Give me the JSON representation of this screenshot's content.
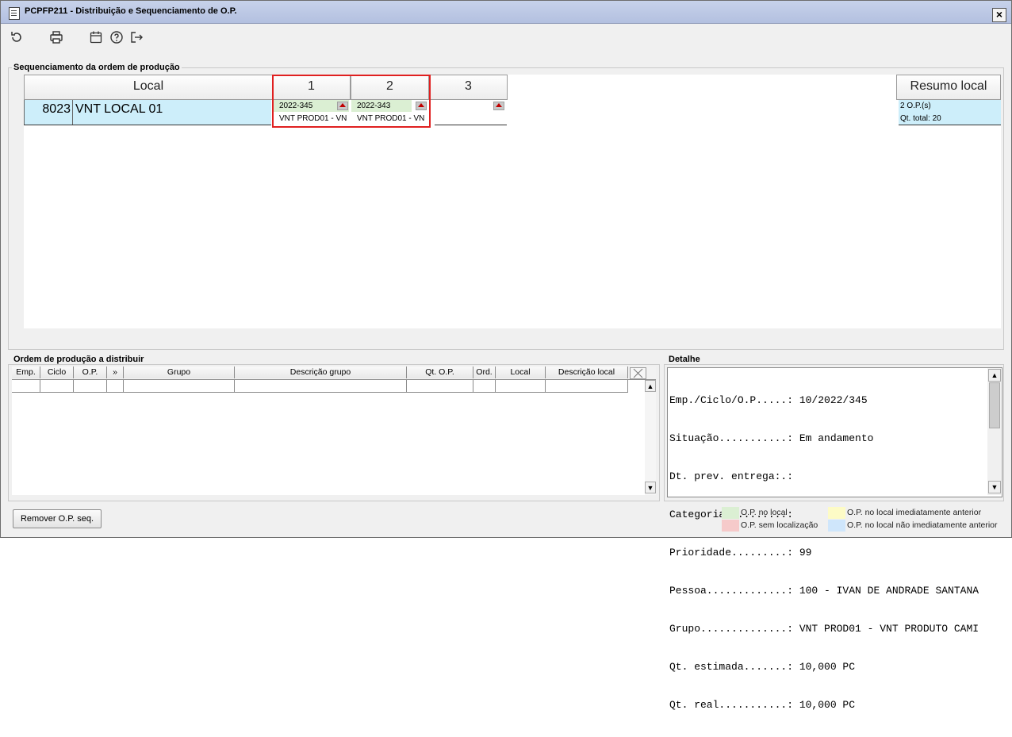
{
  "window": {
    "title": "PCPFP211 - Distribuição e Sequenciamento de O.P.",
    "close_label": "✕"
  },
  "toolbar": {
    "refresh_icon": "refresh-icon",
    "print_icon": "print-icon",
    "calendar_icon": "calendar-icon",
    "help_icon": "help-icon",
    "exit_icon": "exit-icon"
  },
  "seq": {
    "legend": "Sequenciamento da ordem de produção",
    "local_header": "Local",
    "columns": [
      "1",
      "2",
      "3"
    ],
    "resumo_header": "Resumo local",
    "row": {
      "code": "8023",
      "name": "VNT LOCAL 01",
      "cells": [
        {
          "op": "2022-345",
          "desc": "VNT PROD01 - VN"
        },
        {
          "op": "2022-343",
          "desc": "VNT PROD01 - VN"
        },
        {
          "op": "",
          "desc": ""
        }
      ],
      "resumo_count": "2 O.P.(s)",
      "resumo_total": "Qt. total: 20"
    }
  },
  "ops": {
    "legend": "Ordem de produção a distribuir",
    "headers": [
      "Emp.",
      "Ciclo",
      "O.P.",
      "»",
      "Grupo",
      "Descrição grupo",
      "Qt. O.P.",
      "Ord.",
      "Local",
      "Descrição local"
    ]
  },
  "detail": {
    "legend": "Detalhe",
    "lines": [
      "Emp./Ciclo/O.P.....: 10/2022/345",
      "Situação...........: Em andamento",
      "Dt. prev. entrega:.:",
      "Categoria..........:",
      "Prioridade.........: 99",
      "Pessoa.............: 100 - IVAN DE ANDRADE SANTANA",
      "Grupo..............: VNT PROD01 - VNT PRODUTO CAMI",
      "Qt. estimada.......: 10,000 PC",
      "Qt. real...........: 10,000 PC"
    ]
  },
  "buttons": {
    "remove": "Remover O.P. seq."
  },
  "legend": [
    {
      "label": "O.P. no local",
      "color": "#dbefd3"
    },
    {
      "label": "O.P. no local imediatamente anterior",
      "color": "#fdfbc6"
    },
    {
      "label": "O.P. sem localização",
      "color": "#f6caca"
    },
    {
      "label": "O.P. no local não imediatamente anterior",
      "color": "#cfe6fb"
    }
  ],
  "colors": {
    "accent_red": "#e02020",
    "row_blue": "#cdeefa",
    "op_green": "#dbefd3"
  }
}
